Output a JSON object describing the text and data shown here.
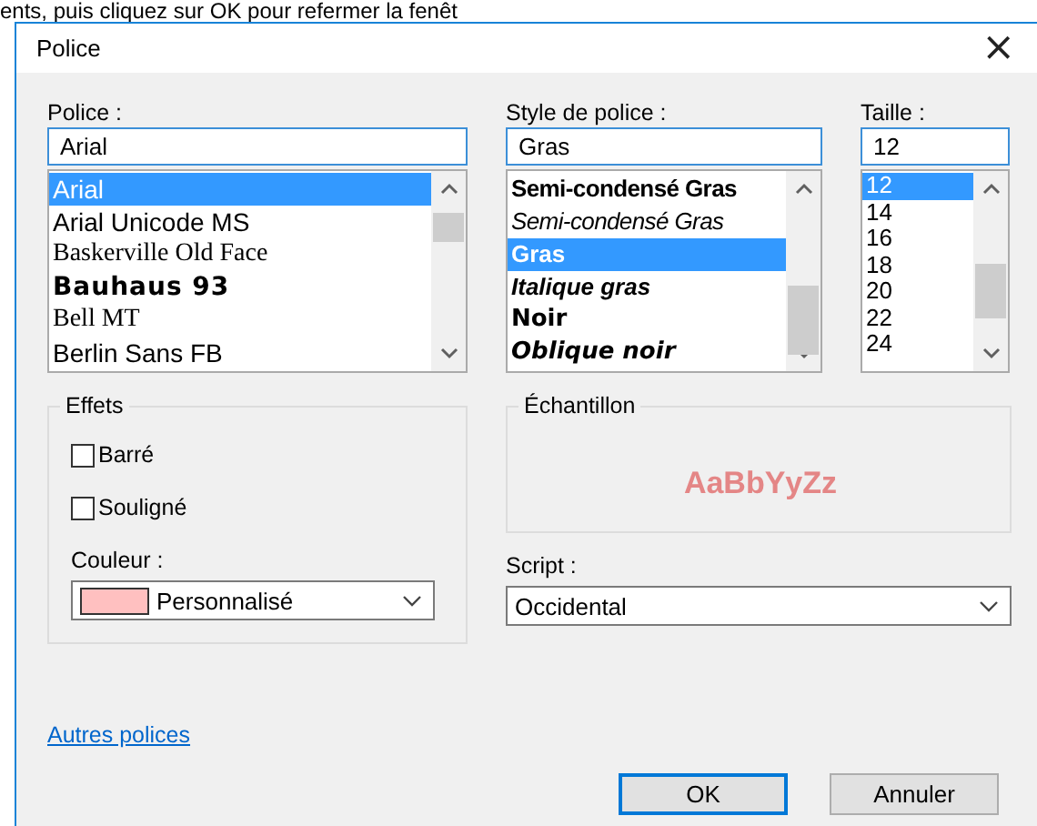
{
  "background_text": "ents, puis cliquez sur OK pour refermer la fenêt",
  "window": {
    "title": "Police",
    "close": "×"
  },
  "font": {
    "label": "Police :",
    "value": "Arial",
    "items": [
      {
        "label": "Arial",
        "kind": "sans",
        "selected": true
      },
      {
        "label": "Arial Unicode MS",
        "kind": "sans",
        "selected": false
      },
      {
        "label": "Baskerville Old Face",
        "kind": "serif",
        "selected": false
      },
      {
        "label": "Bauhaus 93",
        "kind": "display",
        "selected": false
      },
      {
        "label": "Bell MT",
        "kind": "serif",
        "selected": false
      },
      {
        "label": "Berlin Sans FB",
        "kind": "sans",
        "selected": false
      }
    ]
  },
  "style": {
    "label": "Style de police :",
    "value": "Gras",
    "items": [
      {
        "label": "Semi-condensé Gras",
        "kind": "bold-condensed",
        "selected": false
      },
      {
        "label": "Semi-condensé Gras",
        "kind": "italic-condensed",
        "selected": false
      },
      {
        "label": "Gras",
        "kind": "bold",
        "selected": true
      },
      {
        "label": "Italique gras",
        "kind": "bold-italic",
        "selected": false
      },
      {
        "label": "Noir",
        "kind": "black",
        "selected": false
      },
      {
        "label": "Oblique noir",
        "kind": "black-italic",
        "selected": false
      }
    ]
  },
  "size": {
    "label": "Taille :",
    "value": "12",
    "items": [
      {
        "label": "12",
        "selected": true
      },
      {
        "label": "14",
        "selected": false
      },
      {
        "label": "16",
        "selected": false
      },
      {
        "label": "18",
        "selected": false
      },
      {
        "label": "20",
        "selected": false
      },
      {
        "label": "22",
        "selected": false
      },
      {
        "label": "24",
        "selected": false
      }
    ]
  },
  "effects": {
    "title": "Effets",
    "options": [
      {
        "label": "Barré",
        "checked": false
      },
      {
        "label": "Souligné",
        "checked": false
      }
    ],
    "color_label": "Couleur :",
    "color_value": "Personnalisé",
    "color": "#ffc0c0"
  },
  "sample": {
    "title": "Échantillon",
    "text": "AaBbYyZz"
  },
  "script": {
    "label": "Script :",
    "value": "Occidental"
  },
  "link": "Autres polices",
  "buttons": [
    "OK",
    "Annuler"
  ]
}
